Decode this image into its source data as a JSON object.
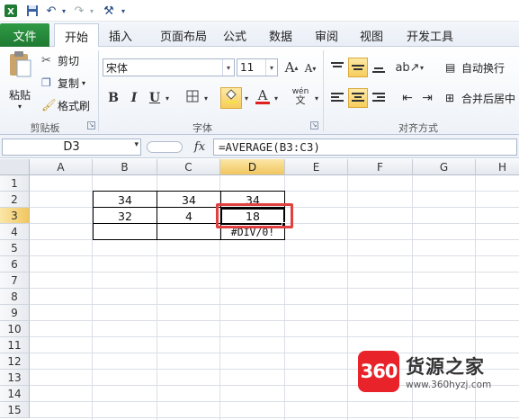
{
  "qat": {
    "app_icon": "excel-icon",
    "save_icon": "save-icon",
    "undo_icon": "undo-icon",
    "redo_icon": "redo-icon",
    "tools_icon": "tools-icon",
    "customize_icon": "customize-qat-icon"
  },
  "tabs": {
    "file": "文件",
    "items": [
      "开始",
      "插入",
      "页面布局",
      "公式",
      "数据",
      "审阅",
      "视图",
      "开发工具"
    ]
  },
  "ribbon": {
    "clipboard": {
      "paste": "粘贴",
      "cut": "剪切",
      "copy": "复制",
      "format_painter": "格式刷",
      "group_label": "剪贴板"
    },
    "font": {
      "font_name": "宋体",
      "font_size": "11",
      "bold": "B",
      "italic": "I",
      "underline": "U",
      "font_color_letter": "A",
      "grow_font": "A",
      "shrink_font": "A",
      "phonetic": "wén",
      "group_label": "字体"
    },
    "alignment": {
      "wrap_text": "自动换行",
      "merge_center": "合并后居中",
      "group_label": "对齐方式"
    },
    "colors": {
      "font_color_bar": "#e02020",
      "fill_color_bar": "#f4e04d",
      "highlight": "#f7cd5c"
    }
  },
  "formula_bar": {
    "name_box": "D3",
    "fx": "fx",
    "formula": "=AVERAGE(B3:C3)"
  },
  "sheet": {
    "columns": [
      "A",
      "B",
      "C",
      "D",
      "E",
      "F",
      "G",
      "H"
    ],
    "selected_column": "D",
    "rows": [
      "1",
      "2",
      "3",
      "4",
      "5",
      "6",
      "7",
      "8",
      "9",
      "10",
      "11",
      "12",
      "13",
      "14",
      "15"
    ],
    "selected_row": "3",
    "cells": {
      "B2": "34",
      "C2": "34",
      "D2": "34",
      "B3": "32",
      "C3": "4",
      "D3": "18",
      "D4": "#DIV/0!"
    },
    "highlight_color": "#e04040"
  },
  "watermark": {
    "badge": "360",
    "title": "货源之家",
    "url": "www.360hyzj.com"
  }
}
